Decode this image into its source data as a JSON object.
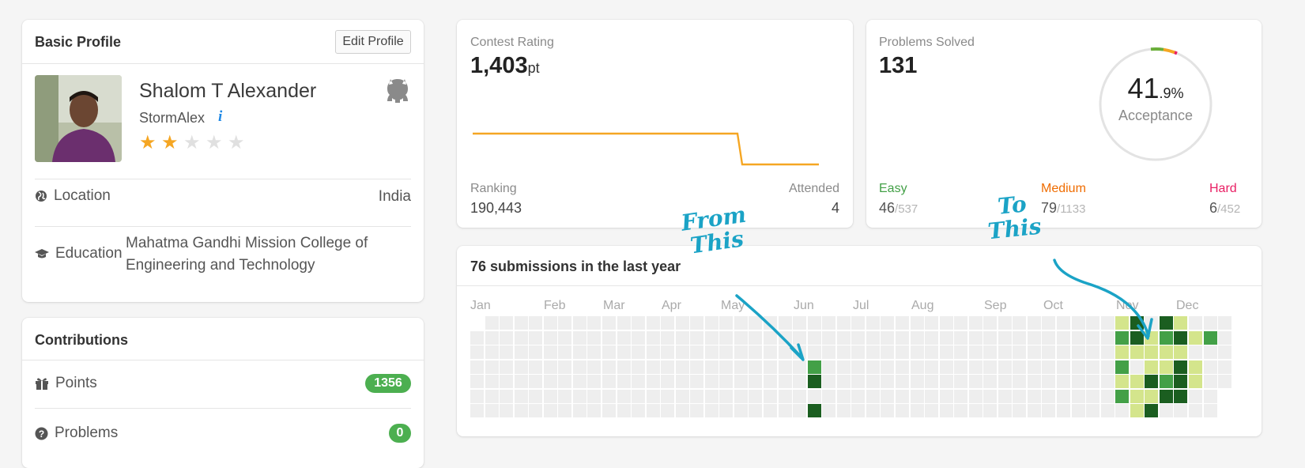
{
  "profile": {
    "title": "Basic Profile",
    "edit_label": "Edit Profile",
    "name": "Shalom T Alexander",
    "username": "StormAlex",
    "info_glyph": "i",
    "rating_stars": 2,
    "max_stars": 5,
    "location_label": "Location",
    "location_value": "India",
    "education_label": "Education",
    "education_line1": "Mahatma Gandhi Mission College of",
    "education_line2": "Engineering and Technology"
  },
  "contributions": {
    "title": "Contributions",
    "points_label": "Points",
    "points_value": "1356",
    "problems_label": "Problems",
    "problems_value": "0"
  },
  "contest": {
    "title": "Contest Rating",
    "rating": "1,403",
    "rating_unit": "pt",
    "ranking_label": "Ranking",
    "ranking_value": "190,443",
    "attended_label": "Attended",
    "attended_value": "4",
    "line_color": "#f5a623"
  },
  "problems": {
    "title": "Problems Solved",
    "solved": "131",
    "acceptance_int": "41",
    "acceptance_dec": ".9%",
    "acceptance_label": "Acceptance",
    "easy_label": "Easy",
    "easy_solved": "46",
    "easy_total": "/537",
    "medium_label": "Medium",
    "medium_solved": "79",
    "medium_total": "/1133",
    "hard_label": "Hard",
    "hard_solved": "6",
    "hard_total": "/452",
    "colors": {
      "easy": "#43a047",
      "medium": "#ef6c00",
      "hard": "#e91e63"
    }
  },
  "submissions": {
    "title": "76 submissions in the last year",
    "months": [
      "Jan",
      "Feb",
      "Mar",
      "Apr",
      "May",
      "Jun",
      "Jul",
      "Aug",
      "Sep",
      "Oct",
      "Nov",
      "Dec"
    ],
    "colors": {
      "empty": "#eeeeee",
      "light": "#d4e58c",
      "mid": "#43a047",
      "dark": "#1b5e20"
    }
  },
  "annotations": {
    "from_text": "From This",
    "to_text": "To This",
    "color": "#1ba3c6"
  },
  "icons": {
    "github": "github-icon",
    "location": "globe-icon",
    "education": "graduation-cap-icon",
    "points": "gift-icon",
    "problems": "question-circle-icon"
  }
}
